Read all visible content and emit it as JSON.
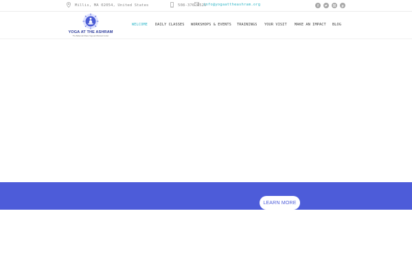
{
  "topbar": {
    "address": "Millis, MA 02054, United States",
    "phone": "508-376-4525",
    "email": "info@yogaattheashram.org",
    "icons": {
      "address": "map-pin-icon",
      "phone": "mobile-phone-icon",
      "email": "envelope-icon"
    },
    "social": [
      {
        "name": "facebook-icon",
        "glyph": "f"
      },
      {
        "name": "twitter-icon",
        "glyph": "t"
      },
      {
        "name": "instagram-icon",
        "glyph": "◘"
      },
      {
        "name": "pinterest-icon",
        "glyph": "p"
      }
    ]
  },
  "logo": {
    "name": "YOGA AT THE ASHRAM",
    "tagline": "The Baba Hari Dass Yoga and Retreat Center",
    "emblem_icon": "meditating-figure-emblem-icon"
  },
  "nav": {
    "items": [
      {
        "label": "WELCOME",
        "active": true
      },
      {
        "label": "DAILY CLASSES",
        "active": false
      },
      {
        "label": "WORKSHOPS & EVENTS",
        "active": false
      },
      {
        "label": "TRAININGS",
        "active": false
      },
      {
        "label": "YOUR VISIT",
        "active": false
      },
      {
        "label": "MAKE AN IMPACT",
        "active": false
      },
      {
        "label": "BLOG",
        "active": false
      }
    ]
  },
  "hero": {
    "cta_label": "LEARN MORE"
  },
  "colors": {
    "accent": "#2bb6c9",
    "band": "#4d5cd9",
    "brand": "#2b3a9a"
  }
}
